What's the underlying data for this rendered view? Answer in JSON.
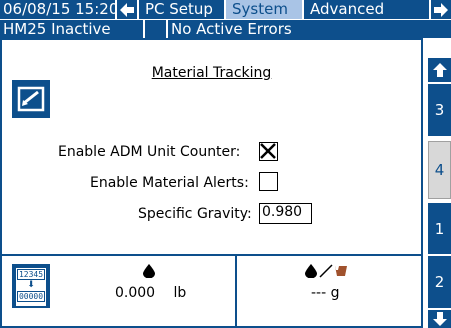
{
  "header": {
    "datetime": "06/08/15 15:20",
    "nav_left_icon": "arrow-left-icon",
    "tabs": [
      {
        "label": "PC Setup",
        "selected": false
      },
      {
        "label": "System",
        "selected": true
      },
      {
        "label": "Advanced",
        "selected": false
      }
    ],
    "nav_right_icon": "arrow-right-icon",
    "status": "HM25 Inactive",
    "errors": "No Active Errors"
  },
  "screen": {
    "title": "Material Tracking",
    "fields": {
      "adm_counter_label": "Enable ADM Unit Counter:",
      "adm_counter_checked": true,
      "adm_counter_mark": "✕",
      "alerts_label": "Enable Material Alerts:",
      "alerts_checked": false,
      "gravity_label": "Specific Gravity:",
      "gravity_value": "0.980"
    }
  },
  "footer": {
    "counter_top": "12345",
    "counter_bottom": "00000",
    "weight_value": "0.000",
    "weight_unit": "lb",
    "ratio_value": "--- g"
  },
  "side_tabs": [
    {
      "label": "3",
      "selected": false
    },
    {
      "label": "4",
      "selected": true
    },
    {
      "label": "1",
      "selected": false
    },
    {
      "label": "2",
      "selected": false
    }
  ],
  "colors": {
    "primary": "#0d4f8c",
    "selected_tab": "#a9c4e6",
    "accent": "#a0522d"
  }
}
